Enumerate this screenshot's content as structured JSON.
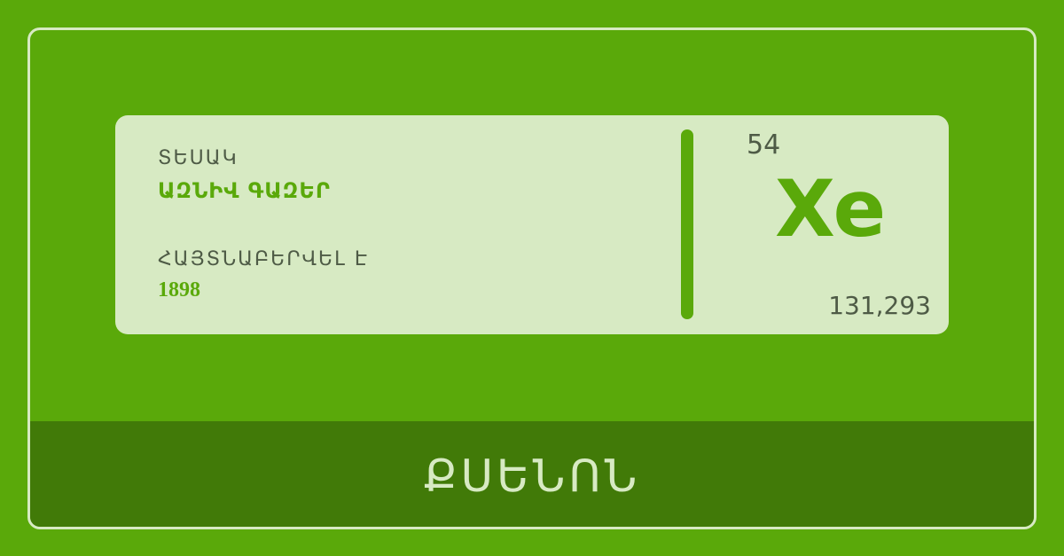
{
  "colors": {
    "background": "#5aa90a",
    "card": "#d7eac3",
    "footer": "#417a08",
    "accent": "#5aa90a",
    "text_dark": "#4e5b46"
  },
  "card": {
    "type_label": "ՏԵՍԱԿ",
    "type_value": "ԱԶՆԻՎ ԳԱԶԵՐ",
    "discovered_label": "ՀԱՅՏՆԱԲԵՐՎԵԼ Է",
    "discovered_value": "1898",
    "atomic_number": "54",
    "symbol": "Xe",
    "atomic_mass": "131,293"
  },
  "footer": {
    "element_name": "ՔՍԵՆՈՆ"
  }
}
